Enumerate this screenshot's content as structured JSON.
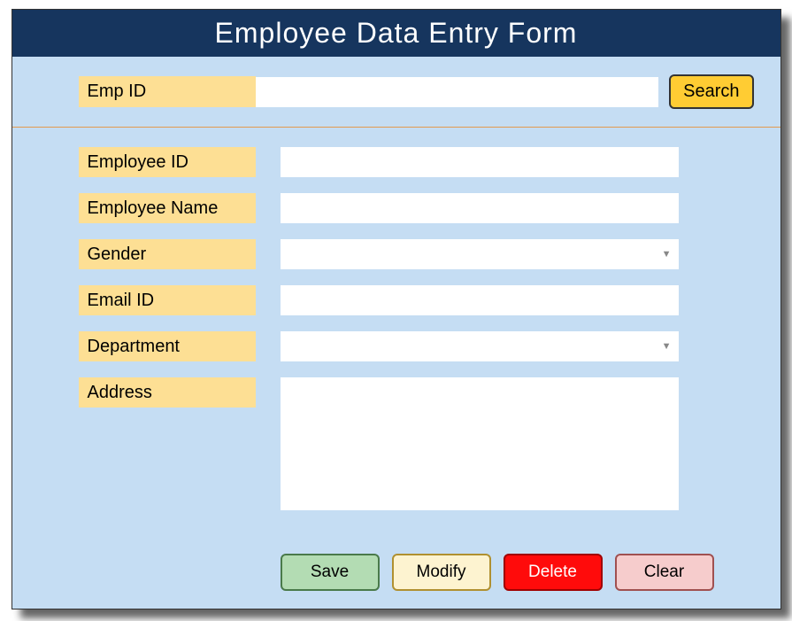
{
  "header": {
    "title": "Employee Data Entry Form"
  },
  "search": {
    "label": "Emp ID",
    "value": "",
    "button": "Search"
  },
  "fields": {
    "employee_id": {
      "label": "Employee ID",
      "value": ""
    },
    "employee_name": {
      "label": "Employee Name",
      "value": ""
    },
    "gender": {
      "label": "Gender",
      "value": ""
    },
    "email_id": {
      "label": "Email ID",
      "value": ""
    },
    "department": {
      "label": "Department",
      "value": ""
    },
    "address": {
      "label": "Address",
      "value": ""
    }
  },
  "buttons": {
    "save": "Save",
    "modify": "Modify",
    "delete": "Delete",
    "clear": "Clear"
  },
  "colors": {
    "header_bg": "#16355e",
    "body_bg": "#c5ddf3",
    "label_bg": "#fddf94",
    "search_btn_bg": "#ffcc33",
    "save_bg": "#b3dcb3",
    "modify_bg": "#fdf3d0",
    "delete_bg": "#ff0b0b",
    "clear_bg": "#f6cccc"
  }
}
